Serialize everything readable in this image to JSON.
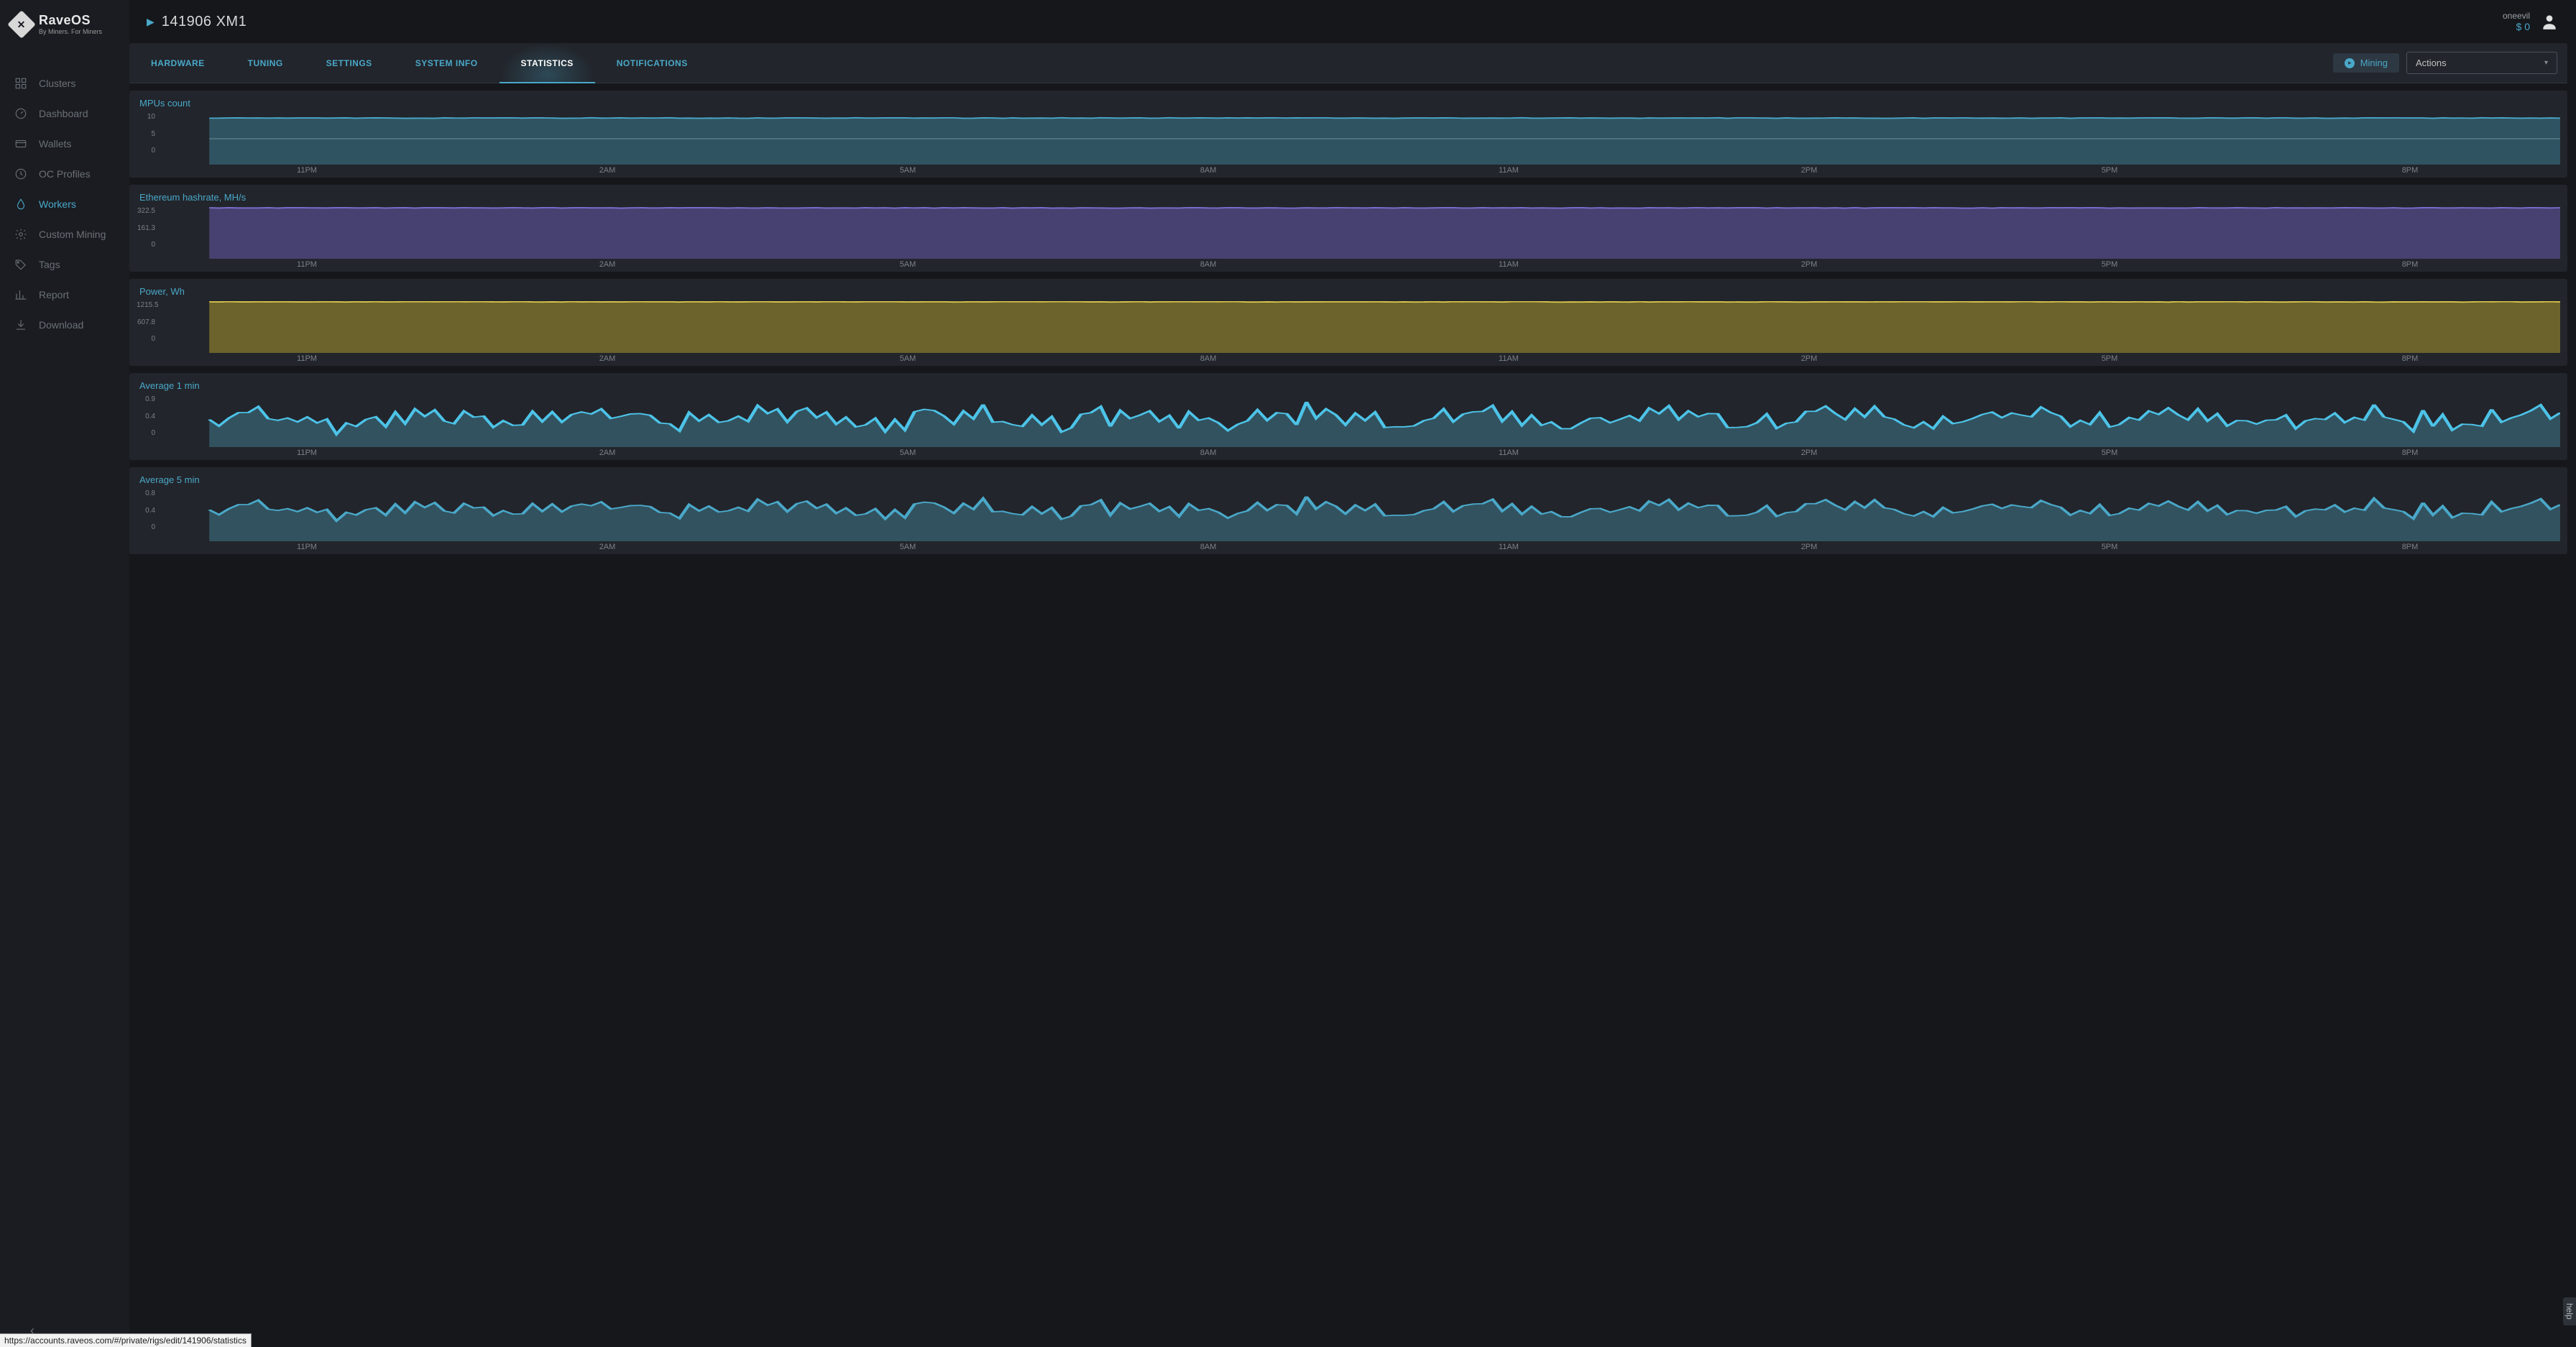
{
  "brand": {
    "title": "RaveOS",
    "subtitle": "By Miners. For Miners"
  },
  "page": {
    "title": "141906 XM1"
  },
  "user": {
    "name": "oneevil",
    "balance": "$ 0"
  },
  "sidebar": {
    "items": [
      {
        "label": "Clusters"
      },
      {
        "label": "Dashboard"
      },
      {
        "label": "Wallets"
      },
      {
        "label": "OC Profiles"
      },
      {
        "label": "Workers"
      },
      {
        "label": "Custom Mining"
      },
      {
        "label": "Tags"
      },
      {
        "label": "Report"
      },
      {
        "label": "Download"
      }
    ]
  },
  "tabs": [
    {
      "label": "HARDWARE"
    },
    {
      "label": "TUNING"
    },
    {
      "label": "SETTINGS"
    },
    {
      "label": "SYSTEM INFO"
    },
    {
      "label": "STATISTICS"
    },
    {
      "label": "NOTIFICATIONS"
    }
  ],
  "mining_label": "Mining",
  "actions_label": "Actions",
  "status_url": "https://accounts.raveos.com/#/private/rigs/edit/141906/statistics",
  "help_label": "help",
  "x_axis": [
    "11PM",
    "2AM",
    "5AM",
    "8AM",
    "11AM",
    "2PM",
    "5PM",
    "8PM"
  ],
  "chart_data": [
    {
      "title": "MPUs count",
      "type": "area",
      "stroke": "#4aa8c9",
      "fill": "rgba(74,168,201,0.35)",
      "y_ticks": [
        "10",
        "5",
        "0"
      ],
      "ylim": [
        0,
        10
      ],
      "value_constant": 9,
      "hatch_at": 5
    },
    {
      "title": "Ethereum hashrate, MH/s",
      "type": "area",
      "stroke": "#7a6fd1",
      "fill": "rgba(100,90,170,0.55)",
      "y_ticks": [
        "322.5",
        "161.3",
        "0"
      ],
      "ylim": [
        0,
        322.5
      ],
      "value_constant": 317
    },
    {
      "title": "Power, Wh",
      "type": "area",
      "stroke": "#d9c84b",
      "fill": "rgba(140,125,45,0.7)",
      "y_ticks": [
        "1215.5",
        "607.8",
        "0"
      ],
      "ylim": [
        0,
        1215.5
      ],
      "value_constant": 1200
    },
    {
      "title": "Average 1 min",
      "type": "area",
      "stroke": "#4dc3e8",
      "fill": "rgba(74,150,175,0.4)",
      "y_ticks": [
        "0.9",
        "0.4",
        "0"
      ],
      "ylim": [
        0,
        0.9
      ],
      "noisy_center": 0.5,
      "noisy_amp": 0.33
    },
    {
      "title": "Average 5 min",
      "type": "area",
      "stroke": "#4aa8c9",
      "fill": "rgba(74,150,175,0.4)",
      "y_ticks": [
        "0.8",
        "0.4",
        "0"
      ],
      "ylim": [
        0,
        0.8
      ],
      "noisy_center": 0.5,
      "noisy_amp": 0.22
    }
  ]
}
